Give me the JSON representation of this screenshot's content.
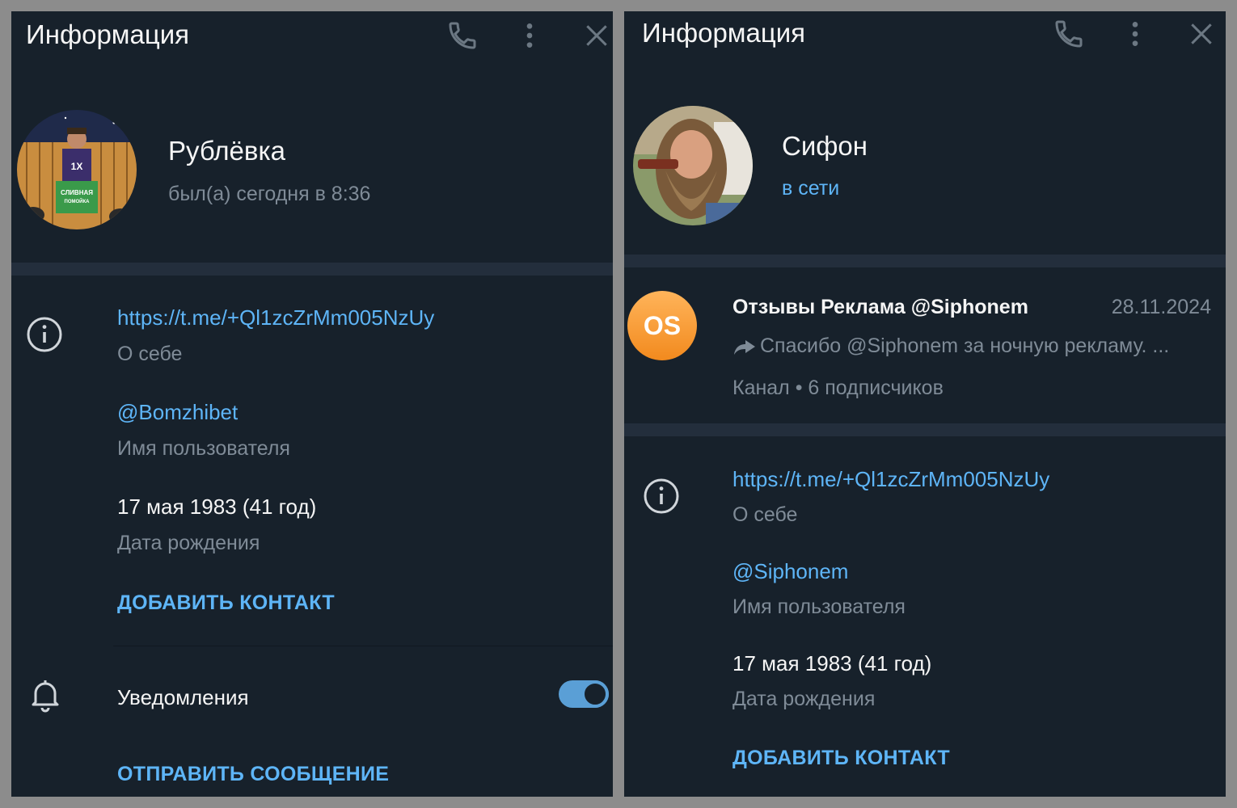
{
  "colors": {
    "panel_bg": "#17212b",
    "separator": "#232e3c",
    "accent": "#5eb5f7",
    "muted_text": "#7f8b97",
    "text": "#f5f5f5",
    "outer_bg": "#8c8c8c",
    "channel_avatar": "#f7931e"
  },
  "left": {
    "header": {
      "title": "Информация",
      "icons": [
        "phone-icon",
        "more-vertical-icon",
        "close-icon"
      ]
    },
    "profile": {
      "name": "Рублёвка",
      "status": "был(а) сегодня в 8:36",
      "avatar_text": [
        "СЛИВНАЯ",
        "ПОМОЙКА"
      ]
    },
    "info": {
      "link": "https://t.me/+Ql1zcZrMm005NzUy",
      "bio_label": "О себе",
      "username": "@Bomzhibet",
      "username_label": "Имя пользователя",
      "birthday": "17 мая 1983 (41 год)",
      "birthday_label": "Дата рождения",
      "add_contact": "ДОБАВИТЬ КОНТАКТ"
    },
    "notifications": {
      "label": "Уведомления",
      "enabled": true
    },
    "send_message": "ОТПРАВИТЬ СООБЩЕНИЕ"
  },
  "right": {
    "header": {
      "title": "Информация",
      "icons": [
        "phone-icon",
        "more-vertical-icon",
        "close-icon"
      ]
    },
    "profile": {
      "name": "Сифон",
      "status": "в сети"
    },
    "channel": {
      "avatar_initials": "OS",
      "title": "Отзывы Реклама @Siphonem",
      "date": "28.11.2024",
      "preview": "Спасибо @Siphonem за ночную рекламу. ...",
      "meta": "Канал • 6 подписчиков"
    },
    "info": {
      "link": "https://t.me/+Ql1zcZrMm005NzUy",
      "bio_label": "О себе",
      "username": "@Siphonem",
      "username_label": "Имя пользователя",
      "birthday": "17 мая 1983 (41 год)",
      "birthday_label": "Дата рождения",
      "add_contact": "ДОБАВИТЬ КОНТАКТ"
    }
  }
}
